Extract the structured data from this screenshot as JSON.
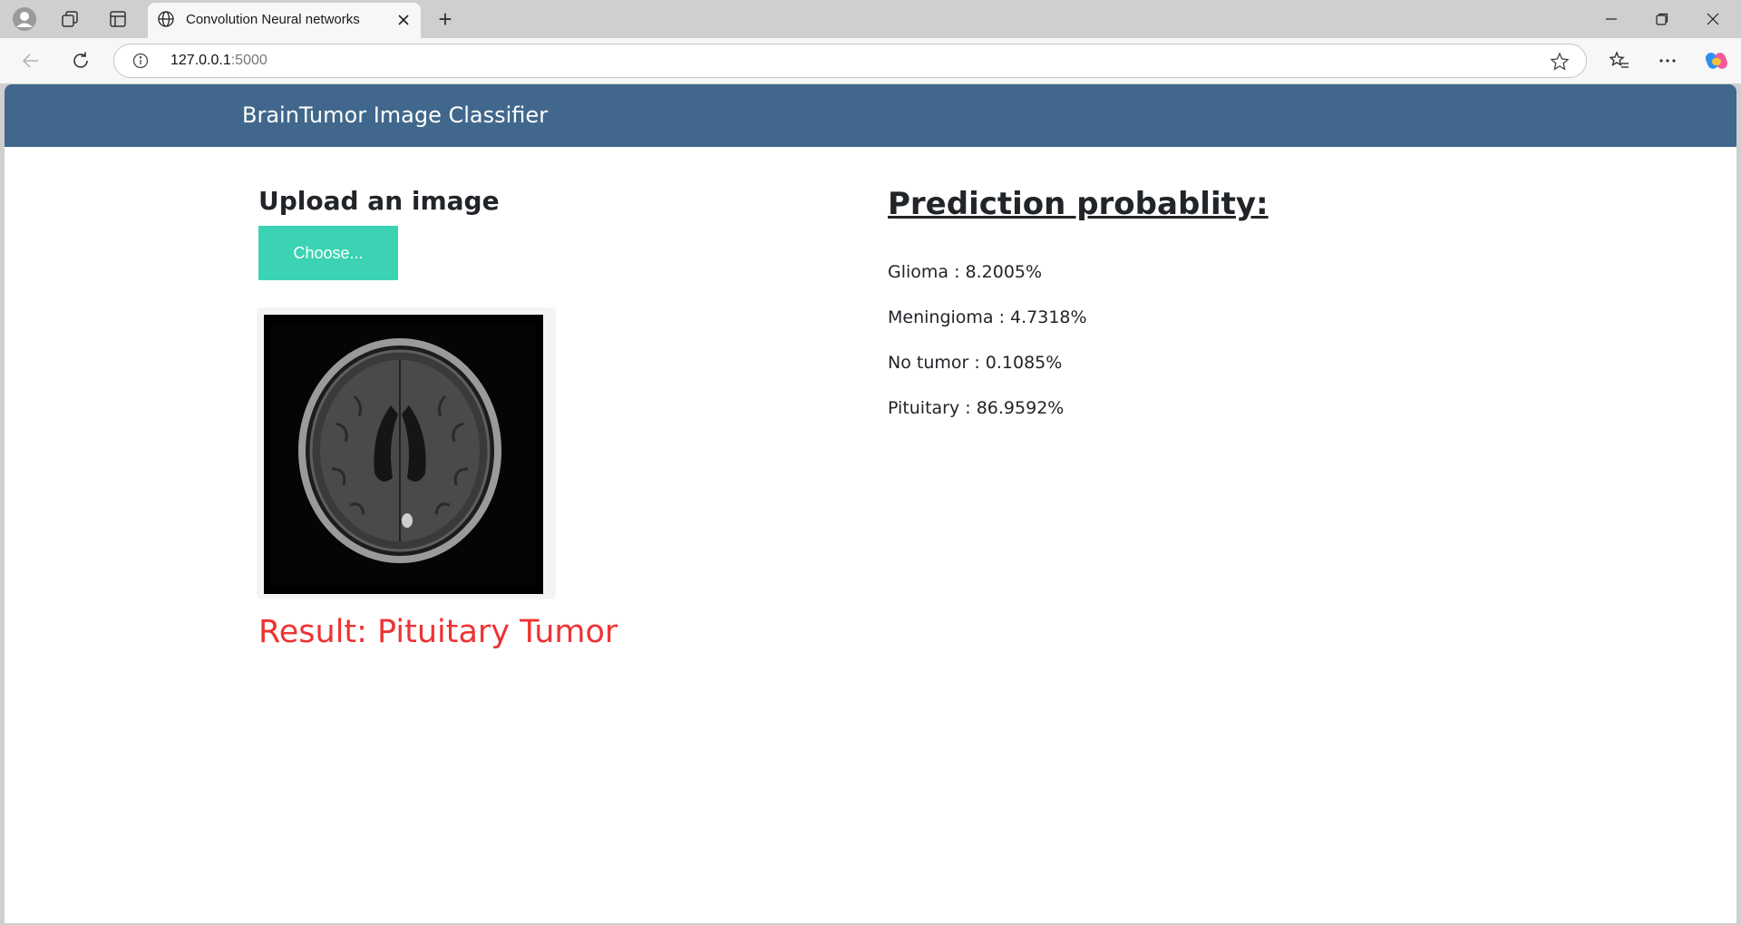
{
  "browser": {
    "tab_title": "Convolution Neural networks",
    "new_tab_label": "+",
    "url_host": "127.0.0.1",
    "url_port": ":5000"
  },
  "page": {
    "brand": "BrainTumor Image Classifier",
    "upload_title": "Upload an image",
    "choose_button": "Choose...",
    "result": "Result: Pituitary Tumor",
    "prediction_title": "Prediction probablity:",
    "predictions": [
      {
        "label": "Glioma : 8.2005%"
      },
      {
        "label": "Meningioma : 4.7318%"
      },
      {
        "label": "No tumor : 0.1085%"
      },
      {
        "label": "Pituitary : 86.9592%"
      }
    ]
  },
  "colors": {
    "header": "#41688c",
    "button": "#3bd3b3",
    "result": "#ee3333"
  },
  "icons": {
    "profile": "profile-icon",
    "workspaces": "workspaces-icon",
    "tab_actions": "tab-actions-icon",
    "site": "globe-icon",
    "back": "back-arrow-icon",
    "reload": "reload-icon",
    "info": "info-icon",
    "favorite": "star-icon",
    "favorites": "favorites-icon",
    "more": "more-icon",
    "copilot": "copilot-icon"
  }
}
